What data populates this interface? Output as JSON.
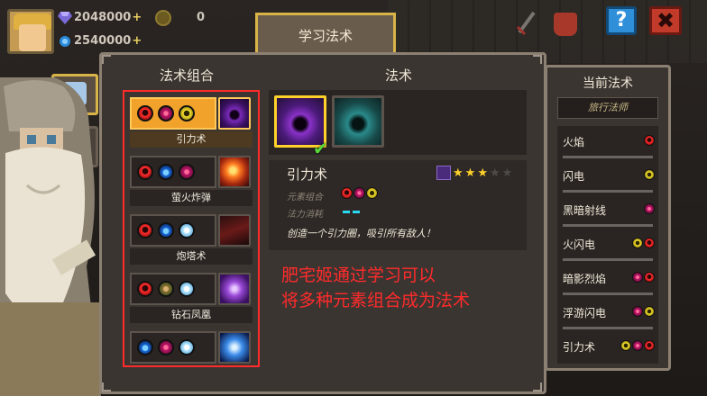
{
  "hud": {
    "gems": "2048000",
    "gems_plus": "+",
    "crystals": "2540000",
    "crystals_plus": "+",
    "coins": "0",
    "help_label": "?",
    "close_label": "✖"
  },
  "tabs": {
    "learn": "学习法术"
  },
  "panel": {
    "combo_title": "法术组合",
    "spell_title": "法术",
    "current_title": "当前法术",
    "current_subtitle": "旅行法师"
  },
  "combos": [
    {
      "name": "引力术",
      "elements": [
        "fire",
        "dark",
        "thunder"
      ],
      "thumb": "gravity",
      "selected": true
    },
    {
      "name": "萤火炸弹",
      "elements": [
        "fire",
        "water",
        "dark"
      ],
      "thumb": "fire",
      "selected": false
    },
    {
      "name": "炮塔术",
      "elements": [
        "fire",
        "water",
        "light"
      ],
      "thumb": "tower",
      "selected": false
    },
    {
      "name": "钻石凤凰",
      "elements": [
        "fire",
        "earth",
        "light"
      ],
      "thumb": "diamond",
      "selected": false
    },
    {
      "name": "",
      "elements": [
        "water",
        "dark",
        "light"
      ],
      "thumb": "blue",
      "selected": false
    }
  ],
  "detail": {
    "name": "引力术",
    "stars_filled": 3,
    "stars_total": 5,
    "element_label": "元素组合",
    "cost_label": "法力消耗",
    "cost_bars": 2,
    "description": "创造一个引力圈，吸引所有敌人！",
    "check_mark": "✔"
  },
  "annotation": {
    "line1": "肥宅姬通过学习可以",
    "line2": "将多种元素组合成为法术"
  },
  "current_spells": [
    {
      "name": "火焰",
      "elements": [
        "fire"
      ]
    },
    {
      "name": "闪电",
      "elements": [
        "thunder"
      ]
    },
    {
      "name": "黑暗射线",
      "elements": [
        "dark"
      ]
    },
    {
      "name": "火闪电",
      "elements": [
        "thunder",
        "fire"
      ]
    },
    {
      "name": "暗影烈焰",
      "elements": [
        "dark",
        "fire"
      ]
    },
    {
      "name": "浮游闪电",
      "elements": [
        "dark",
        "thunder"
      ]
    },
    {
      "name": "引力术",
      "elements": [
        "thunder",
        "dark",
        "fire"
      ]
    }
  ],
  "colors": {
    "accent_gold": "#d8b348",
    "highlight_red": "#ff2b2b",
    "panel_bg": "#3b3531"
  }
}
